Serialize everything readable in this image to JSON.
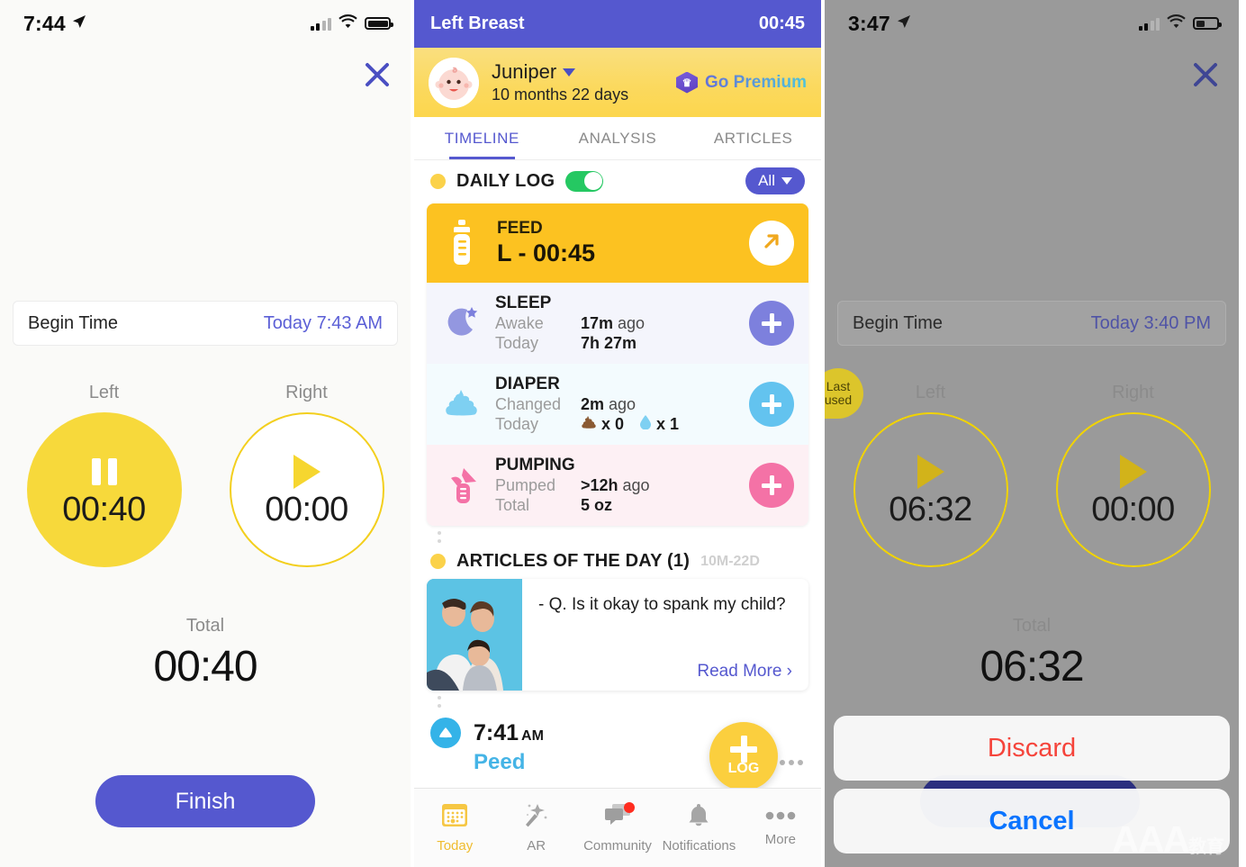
{
  "panel1": {
    "status": {
      "time": "7:44",
      "location_icon": "location-arrow-icon",
      "battery_level": 100
    },
    "close_icon": "close-icon",
    "begin_time": {
      "label": "Begin Time",
      "value": "Today 7:43 AM"
    },
    "timers": {
      "left": {
        "caption": "Left",
        "value": "00:40",
        "state": "running",
        "glyph": "pause-icon"
      },
      "right": {
        "caption": "Right",
        "value": "00:00",
        "state": "idle",
        "glyph": "play-icon"
      },
      "total": {
        "caption": "Total",
        "value": "00:40"
      }
    },
    "finish_label": "Finish"
  },
  "panel2": {
    "header": {
      "title": "Left Breast",
      "timer": "00:45"
    },
    "baby": {
      "name": "Juniper",
      "age": "10 months 22 days",
      "premium_label": "Go Premium",
      "avatar": "baby-face-avatar"
    },
    "tabs": [
      {
        "label": "TIMELINE",
        "active": true
      },
      {
        "label": "ANALYSIS",
        "active": false
      },
      {
        "label": "ARTICLES",
        "active": false
      }
    ],
    "daily_log": {
      "title": "DAILY LOG",
      "toggle_on": true,
      "filter_label": "All"
    },
    "cards": {
      "feed": {
        "title": "FEED",
        "value": "L - 00:45",
        "icon": "bottle-icon",
        "action_icon": "arrow-up-right-icon"
      },
      "sleep": {
        "title": "SLEEP",
        "icon": "moon-star-icon",
        "action_icon": "plus-icon",
        "rows": [
          {
            "key": "Awake",
            "value": "17m ago",
            "bold": "17m",
            "rest": " ago"
          },
          {
            "key": "Today",
            "value": "7h 27m"
          }
        ]
      },
      "diaper": {
        "title": "DIAPER",
        "icon": "poop-cloud-icon",
        "action_icon": "plus-icon",
        "rows": [
          {
            "key": "Changed",
            "value": "2m ago",
            "bold": "2m",
            "rest": " ago"
          },
          {
            "key": "Today",
            "value": "x 0   x 1",
            "poop_count": "x 0",
            "pee_count": "x 1"
          }
        ]
      },
      "pumping": {
        "title": "PUMPING",
        "icon": "breast-pump-icon",
        "action_icon": "plus-icon",
        "rows": [
          {
            "key": "Pumped",
            "value": ">12h ago",
            "bold": ">12h",
            "rest": " ago"
          },
          {
            "key": "Total",
            "value": "5 oz"
          }
        ]
      }
    },
    "articles": {
      "heading": "ARTICLES OF THE DAY (1)",
      "age_tag": "10M-22D",
      "question": "- Q. Is it okay to spank my child?",
      "read_more": "Read More ›",
      "thumb": "family-photo-thumbnail"
    },
    "timeline_entry": {
      "time": "7:41",
      "meridiem": "AM",
      "label": "Peed",
      "icon": "pee-drop-icon"
    },
    "fab": {
      "label": "LOG",
      "icon": "plus-icon",
      "overflow_icon": "ellipsis-icon"
    },
    "tabbar": [
      {
        "label": "Today",
        "icon": "calendar-icon",
        "active": true,
        "badge": false
      },
      {
        "label": "AR",
        "icon": "magic-wand-icon",
        "active": false,
        "badge": false
      },
      {
        "label": "Community",
        "icon": "chat-bubbles-icon",
        "active": false,
        "badge": true
      },
      {
        "label": "Notifications",
        "icon": "bell-icon",
        "active": false,
        "badge": false
      },
      {
        "label": "More",
        "icon": "ellipsis-icon",
        "active": false,
        "badge": false
      }
    ]
  },
  "panel3": {
    "status": {
      "time": "3:47",
      "location_icon": "location-arrow-icon",
      "battery_level": 45
    },
    "close_icon": "close-icon",
    "begin_time": {
      "label": "Begin Time",
      "value": "Today 3:40 PM"
    },
    "timers": {
      "left": {
        "caption": "Left",
        "value": "06:32",
        "state": "paused",
        "glyph": "play-icon",
        "badge": "Last used"
      },
      "right": {
        "caption": "Right",
        "value": "00:00",
        "state": "idle",
        "glyph": "play-icon"
      },
      "total": {
        "caption": "Total",
        "value": "06:32"
      }
    },
    "badge_line1": "Last",
    "badge_line2": "used",
    "action_sheet": {
      "discard": "Discard",
      "cancel": "Cancel"
    },
    "watermark": {
      "main": "AAA",
      "sub": "教育"
    }
  },
  "colors": {
    "accent_purple": "#5558cf",
    "accent_yellow": "#fbcf3e",
    "feed_amber": "#fcc221",
    "sleep_purple": "#7d80dd",
    "diaper_blue": "#63c3ef",
    "pump_pink": "#f472a6",
    "destructive_red": "#f5443b",
    "ios_blue": "#0a74ff",
    "toggle_green": "#25c862"
  }
}
